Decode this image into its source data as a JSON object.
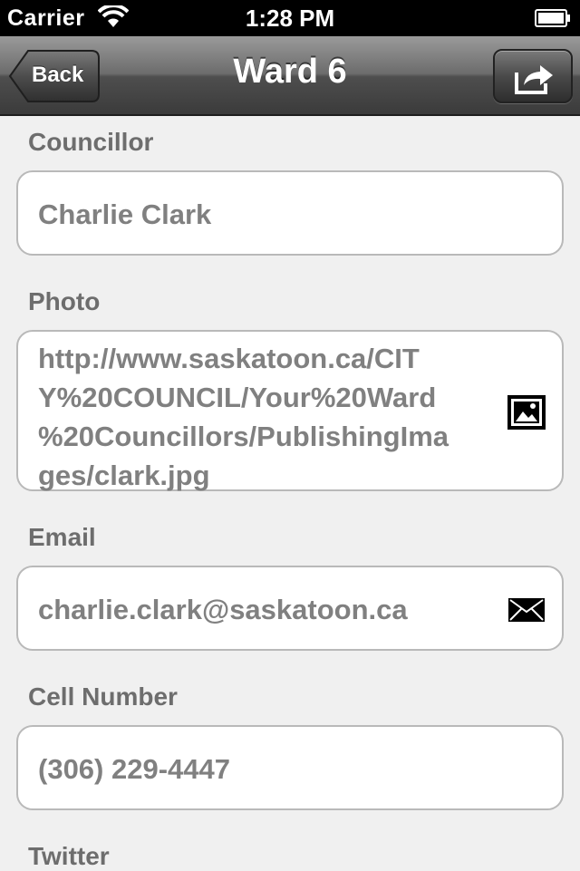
{
  "status_bar": {
    "carrier": "Carrier",
    "time": "1:28 PM"
  },
  "nav": {
    "back_label": "Back",
    "title": "Ward 6"
  },
  "fields": {
    "councillor": {
      "label": "Councillor",
      "value": "Charlie Clark"
    },
    "photo": {
      "label": "Photo",
      "value": "http://www.saskatoon.ca/CITY%20COUNCIL/Your%20Ward%20Councillors/PublishingImages/clark.jpg",
      "value_lines": [
        "http://www.saskatoon.ca/CIT",
        "Y%20COUNCIL/Your%20Ward",
        "%20Councillors/PublishingIma",
        "ges/clark.jpg"
      ]
    },
    "email": {
      "label": "Email",
      "value": "charlie.clark@saskatoon.ca"
    },
    "cell": {
      "label": "Cell Number",
      "value": "(306) 229-4447"
    },
    "twitter": {
      "label": "Twitter"
    }
  },
  "icons": {
    "wifi": "wifi-icon",
    "battery": "battery-icon",
    "share": "share-icon",
    "photo": "image-icon",
    "email": "envelope-icon"
  }
}
